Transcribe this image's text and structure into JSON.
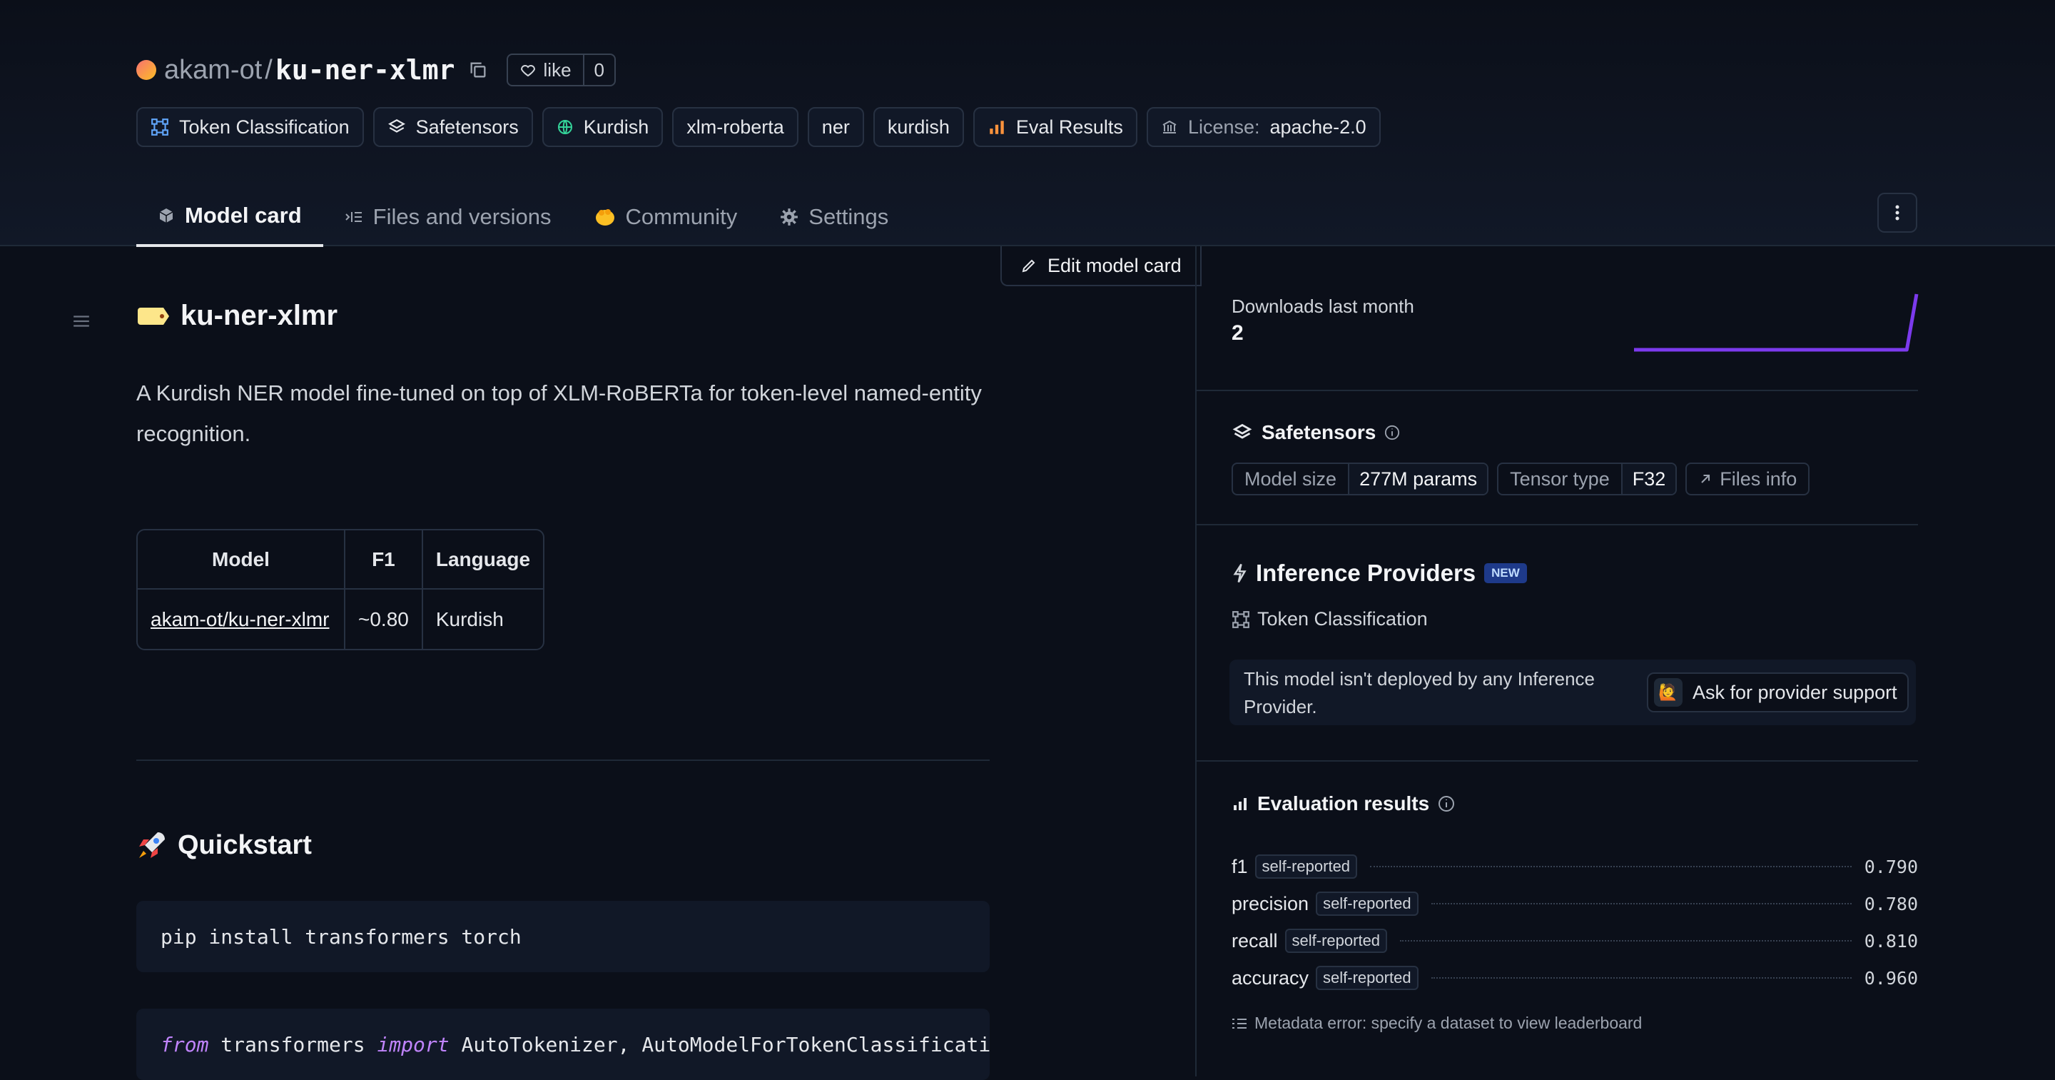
{
  "repo": {
    "owner": "akam-ot",
    "name": "ku-ner-xlmr",
    "like_label": "like",
    "like_count": "0"
  },
  "tags": [
    {
      "label": "Token Classification",
      "icon": "token-classification-icon"
    },
    {
      "label": "Safetensors",
      "icon": "safetensors-icon"
    },
    {
      "label": "Kurdish",
      "icon": "globe-icon"
    },
    {
      "label": "xlm-roberta"
    },
    {
      "label": "ner"
    },
    {
      "label": "kurdish"
    },
    {
      "label": "Eval Results",
      "icon": "bar-chart-icon"
    },
    {
      "label": "apache-2.0",
      "prefix": "License:",
      "icon": "bank-icon"
    }
  ],
  "tabs": [
    {
      "label": "Model card",
      "active": true
    },
    {
      "label": "Files and versions"
    },
    {
      "label": "Community"
    },
    {
      "label": "Settings"
    }
  ],
  "card": {
    "edit_label": "Edit model card",
    "title": "ku-ner-xlmr",
    "description": "A Kurdish NER model fine-tuned on top of XLM-RoBERTa for token-level named-entity recognition.",
    "table": {
      "headers": [
        "Model",
        "F1",
        "Language"
      ],
      "rows": [
        [
          "akam-ot/ku-ner-xlmr",
          "~0.80",
          "Kurdish"
        ]
      ]
    },
    "quickstart_title": "Quickstart",
    "code1": "pip install transformers torch",
    "code2": {
      "kw1": "from",
      "mod": " transformers ",
      "kw2": "import",
      "rest": " AutoTokenizer, AutoModelForTokenClassification"
    }
  },
  "sidebar": {
    "downloads_label": "Downloads last month",
    "downloads_value": "2",
    "downloads_series": [
      0,
      0,
      0,
      0,
      0,
      0,
      0,
      0,
      0,
      0,
      0,
      0,
      0,
      0,
      0,
      0,
      0,
      0,
      0,
      0,
      0,
      0,
      0,
      0,
      0,
      0,
      0,
      0,
      0,
      2
    ],
    "accent": "#7c3aed",
    "safetensors": {
      "title": "Safetensors",
      "model_size_label": "Model size",
      "model_size_value": "277M params",
      "tensor_type_label": "Tensor type",
      "tensor_type_value": "F32",
      "files_info_label": "Files info"
    },
    "inference": {
      "title": "Inference Providers",
      "badge": "NEW",
      "task": "Token Classification",
      "notice": "This model isn't deployed by any Inference Provider.",
      "ask_label": "Ask for provider support"
    },
    "eval": {
      "title": "Evaluation results",
      "rows": [
        {
          "metric": "f1",
          "badge": "self-reported",
          "value": "0.790"
        },
        {
          "metric": "precision",
          "badge": "self-reported",
          "value": "0.780"
        },
        {
          "metric": "recall",
          "badge": "self-reported",
          "value": "0.810"
        },
        {
          "metric": "accuracy",
          "badge": "self-reported",
          "value": "0.960"
        }
      ],
      "meta_error": "Metadata error: specify a dataset to view leaderboard"
    }
  }
}
